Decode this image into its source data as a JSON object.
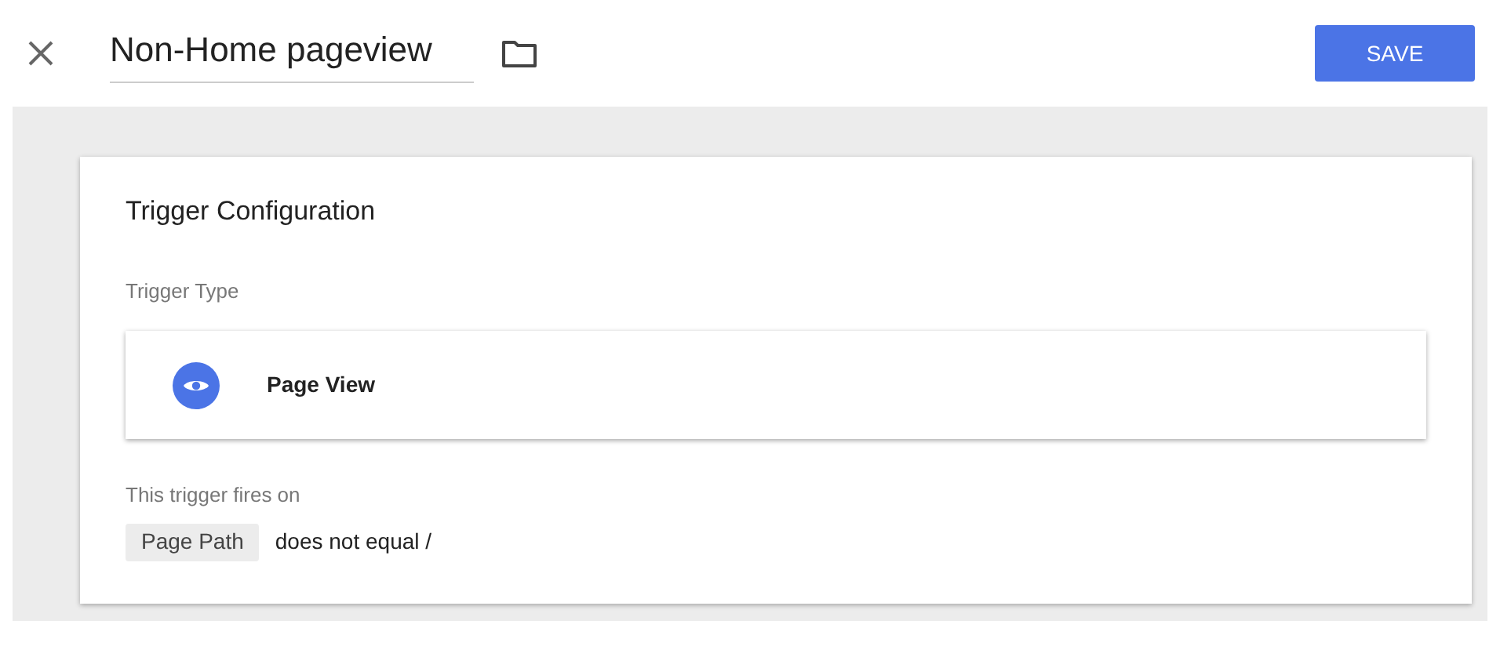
{
  "header": {
    "title": "Non-Home pageview",
    "save_label": "SAVE"
  },
  "card": {
    "title": "Trigger Configuration",
    "type_label": "Trigger Type",
    "trigger_type": "Page View",
    "fires_label": "This trigger fires on",
    "condition": {
      "variable": "Page Path",
      "rule": "does not equal /"
    }
  }
}
